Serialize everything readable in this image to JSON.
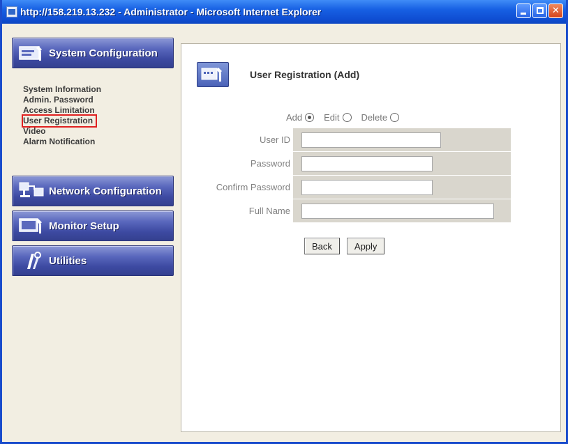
{
  "window": {
    "title": "http://158.219.13.232 - Administrator - Microsoft Internet Explorer"
  },
  "sidebar": {
    "system_configuration": {
      "label": "System Configuration",
      "items": [
        {
          "label": "System Information"
        },
        {
          "label": "Admin. Password"
        },
        {
          "label": "Access Limitation"
        },
        {
          "label": "User Registration"
        },
        {
          "label": "Video"
        },
        {
          "label": "Alarm Notification"
        }
      ],
      "selected_item": "User Registration"
    },
    "network_configuration": {
      "label": "Network Configuration"
    },
    "monitor_setup": {
      "label": "Monitor Setup"
    },
    "utilities": {
      "label": "Utilities"
    }
  },
  "main": {
    "title": "User Registration (Add)",
    "modes": [
      {
        "label": "Add",
        "checked": true
      },
      {
        "label": "Edit",
        "checked": false
      },
      {
        "label": "Delete",
        "checked": false
      }
    ],
    "fields": [
      {
        "label": "User ID",
        "value": ""
      },
      {
        "label": "Password",
        "value": ""
      },
      {
        "label": "Confirm Password",
        "value": ""
      },
      {
        "label": "Full Name",
        "value": ""
      }
    ],
    "buttons": {
      "back": "Back",
      "apply": "Apply"
    }
  },
  "colors": {
    "titlebar": "#1760e3",
    "menu_header": "#4a58b0",
    "highlight_box": "#e02020",
    "form_cell": "#d9d6cd"
  }
}
